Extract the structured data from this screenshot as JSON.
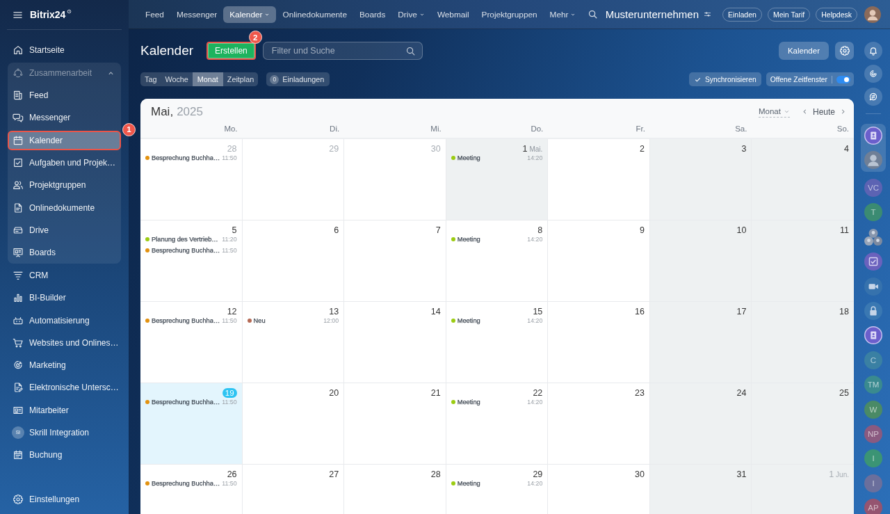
{
  "sidebar": {
    "logo": "Bitrix24",
    "items": [
      {
        "kind": "link",
        "label": "Startseite",
        "selected": false
      },
      {
        "kind": "group",
        "label": "Zusammenarbeit",
        "expanded": true,
        "children": [
          {
            "label": "Feed",
            "selected": false
          },
          {
            "label": "Messenger",
            "selected": false
          },
          {
            "label": "Kalender",
            "selected": true,
            "callout": "1"
          },
          {
            "label": "Aufgaben und Projek…",
            "selected": false
          },
          {
            "label": "Projektgruppen",
            "selected": false
          },
          {
            "label": "Onlinedokumente",
            "selected": false
          },
          {
            "label": "Drive",
            "selected": false
          },
          {
            "label": "Boards",
            "selected": false
          }
        ]
      },
      {
        "kind": "link",
        "label": "CRM",
        "selected": false
      },
      {
        "kind": "link",
        "label": "BI-Builder",
        "selected": false
      },
      {
        "kind": "link",
        "label": "Automatisierung",
        "selected": false
      },
      {
        "kind": "link",
        "label": "Websites und Onlines…",
        "selected": false
      },
      {
        "kind": "link",
        "label": "Marketing",
        "selected": false
      },
      {
        "kind": "link",
        "label": "Elektronische Untersc…",
        "selected": false
      },
      {
        "kind": "link",
        "label": "Mitarbeiter",
        "selected": false
      },
      {
        "kind": "link",
        "label": "Skrill Integration",
        "selected": false,
        "avatar": "SI"
      },
      {
        "kind": "link",
        "label": "Buchung",
        "selected": false
      }
    ],
    "settings": "Einstellungen"
  },
  "top_bar": {
    "nav": [
      {
        "label": "Feed",
        "selected": false,
        "dropdown": false
      },
      {
        "label": "Messenger",
        "selected": false,
        "dropdown": false
      },
      {
        "label": "Kalender",
        "selected": true,
        "dropdown": true
      },
      {
        "label": "Onlinedokumente",
        "selected": false,
        "dropdown": false
      },
      {
        "label": "Boards",
        "selected": false,
        "dropdown": false
      },
      {
        "label": "Drive",
        "selected": false,
        "dropdown": true
      },
      {
        "label": "Webmail",
        "selected": false,
        "dropdown": false
      },
      {
        "label": "Projektgruppen",
        "selected": false,
        "dropdown": false
      },
      {
        "label": "Mehr",
        "selected": false,
        "dropdown": true
      }
    ],
    "company": "Musterunternehmen",
    "buttons": [
      "Einladen",
      "Mein Tarif",
      "Helpdesk"
    ]
  },
  "toolbar": {
    "title": "Kalender",
    "create_button": {
      "label": "Erstellen",
      "callout": "2"
    },
    "search": {
      "placeholder": "Filter und Suche"
    },
    "calendars_button": "Kalender",
    "views": [
      {
        "label": "Tag",
        "selected": false
      },
      {
        "label": "Woche",
        "selected": false
      },
      {
        "label": "Monat",
        "selected": true
      },
      {
        "label": "Zeitplan",
        "selected": false
      }
    ],
    "invitations": {
      "count": "0",
      "label": "Einladungen"
    },
    "sync_button": "Synchronisieren",
    "open_slots": {
      "label": "Offene Zeitfenster",
      "on": true
    }
  },
  "calendar": {
    "month": "Mai,",
    "year": "2025",
    "view_select": "Monat",
    "today_button": "Heute",
    "weekdays": [
      "Mo.",
      "Di.",
      "Mi.",
      "Do.",
      "Fr.",
      "Sa.",
      "So."
    ],
    "weeks": [
      [
        {
          "day": "28",
          "kind": "weekday",
          "other_month": true,
          "events": [
            {
              "title": "Besprechung Buchha…",
              "time": "11:50",
              "color": "#e3920f"
            }
          ]
        },
        {
          "day": "29",
          "kind": "weekday",
          "other_month": true
        },
        {
          "day": "30",
          "kind": "weekday",
          "other_month": true
        },
        {
          "day": "1",
          "month": "Mai.",
          "kind": "holiday",
          "other_month": false,
          "events": [
            {
              "title": "Meeting",
              "time": "14:20",
              "color": "#9bcc12"
            }
          ]
        },
        {
          "day": "2",
          "kind": "weekday",
          "other_month": false
        },
        {
          "day": "3",
          "kind": "weekend",
          "other_month": false
        },
        {
          "day": "4",
          "kind": "weekend",
          "other_month": false
        }
      ],
      [
        {
          "day": "5",
          "kind": "weekday",
          "other_month": false,
          "events": [
            {
              "title": "Planung des Vertrieb…",
              "time": "11:20",
              "color": "#9bcc12"
            },
            {
              "title": "Besprechung Buchha…",
              "time": "11:50",
              "color": "#e3920f"
            }
          ]
        },
        {
          "day": "6",
          "kind": "weekday",
          "other_month": false
        },
        {
          "day": "7",
          "kind": "weekday",
          "other_month": false
        },
        {
          "day": "8",
          "kind": "weekday",
          "other_month": false,
          "events": [
            {
              "title": "Meeting",
              "time": "14:20",
              "color": "#9bcc12"
            }
          ]
        },
        {
          "day": "9",
          "kind": "weekday",
          "other_month": false
        },
        {
          "day": "10",
          "kind": "weekend",
          "other_month": false
        },
        {
          "day": "11",
          "kind": "weekend",
          "other_month": false
        }
      ],
      [
        {
          "day": "12",
          "kind": "weekday",
          "other_month": false,
          "events": [
            {
              "title": "Besprechung Buchha…",
              "time": "11:50",
              "color": "#e3920f"
            }
          ]
        },
        {
          "day": "13",
          "kind": "weekday",
          "other_month": false,
          "events": [
            {
              "title": "Neu",
              "time": "12:00",
              "color": "#b56a55"
            }
          ]
        },
        {
          "day": "14",
          "kind": "weekday",
          "other_month": false
        },
        {
          "day": "15",
          "kind": "weekday",
          "other_month": false,
          "events": [
            {
              "title": "Meeting",
              "time": "14:20",
              "color": "#9bcc12"
            }
          ]
        },
        {
          "day": "16",
          "kind": "weekday",
          "other_month": false
        },
        {
          "day": "17",
          "kind": "weekend",
          "other_month": false
        },
        {
          "day": "18",
          "kind": "weekend",
          "other_month": false
        }
      ],
      [
        {
          "day": "19",
          "kind": "today",
          "other_month": false,
          "events": [
            {
              "title": "Besprechung Buchha…",
              "time": "11:50",
              "color": "#e3920f"
            }
          ]
        },
        {
          "day": "20",
          "kind": "weekday",
          "other_month": false
        },
        {
          "day": "21",
          "kind": "weekday",
          "other_month": false
        },
        {
          "day": "22",
          "kind": "weekday",
          "other_month": false,
          "events": [
            {
              "title": "Meeting",
              "time": "14:20",
              "color": "#9bcc12"
            }
          ]
        },
        {
          "day": "23",
          "kind": "weekday",
          "other_month": false
        },
        {
          "day": "24",
          "kind": "weekend",
          "other_month": false
        },
        {
          "day": "25",
          "kind": "weekend",
          "other_month": false
        }
      ],
      [
        {
          "day": "26",
          "kind": "weekday",
          "other_month": false,
          "events": [
            {
              "title": "Besprechung Buchha…",
              "time": "11:50",
              "color": "#e3920f"
            }
          ]
        },
        {
          "day": "27",
          "kind": "weekday",
          "other_month": false
        },
        {
          "day": "28",
          "kind": "weekday",
          "other_month": false
        },
        {
          "day": "29",
          "kind": "weekday",
          "other_month": false,
          "events": [
            {
              "title": "Meeting",
              "time": "14:20",
              "color": "#9bcc12"
            }
          ]
        },
        {
          "day": "30",
          "kind": "weekday",
          "other_month": false
        },
        {
          "day": "31",
          "kind": "weekend",
          "other_month": false
        },
        {
          "day": "1",
          "month": "Jun.",
          "kind": "weekend",
          "other_month": true
        }
      ]
    ]
  },
  "right_rail": {
    "pinned": [
      {
        "kind": "contacts"
      },
      {
        "kind": "photo"
      }
    ],
    "recent": [
      {
        "kind": "initials",
        "initials": "VC",
        "color": "#5c63b3"
      },
      {
        "kind": "initials",
        "initials": "T",
        "color": "#3b8b72"
      },
      {
        "kind": "team"
      },
      {
        "kind": "tasks"
      },
      {
        "kind": "video"
      },
      {
        "kind": "lock"
      },
      {
        "kind": "contacts"
      },
      {
        "kind": "initials",
        "initials": "C",
        "color": "#3a80a3"
      },
      {
        "kind": "initials",
        "initials": "TM",
        "color": "#3a8a8f"
      },
      {
        "kind": "initials",
        "initials": "W",
        "color": "#4a8a66"
      },
      {
        "kind": "initials",
        "initials": "NP",
        "color": "#8a5a80"
      },
      {
        "kind": "initials",
        "initials": "I",
        "color": "#3b9474"
      },
      {
        "kind": "initials",
        "initials": "I",
        "color": "#6b6f9c"
      },
      {
        "kind": "initials",
        "initials": "AP",
        "color": "#955470"
      }
    ]
  }
}
